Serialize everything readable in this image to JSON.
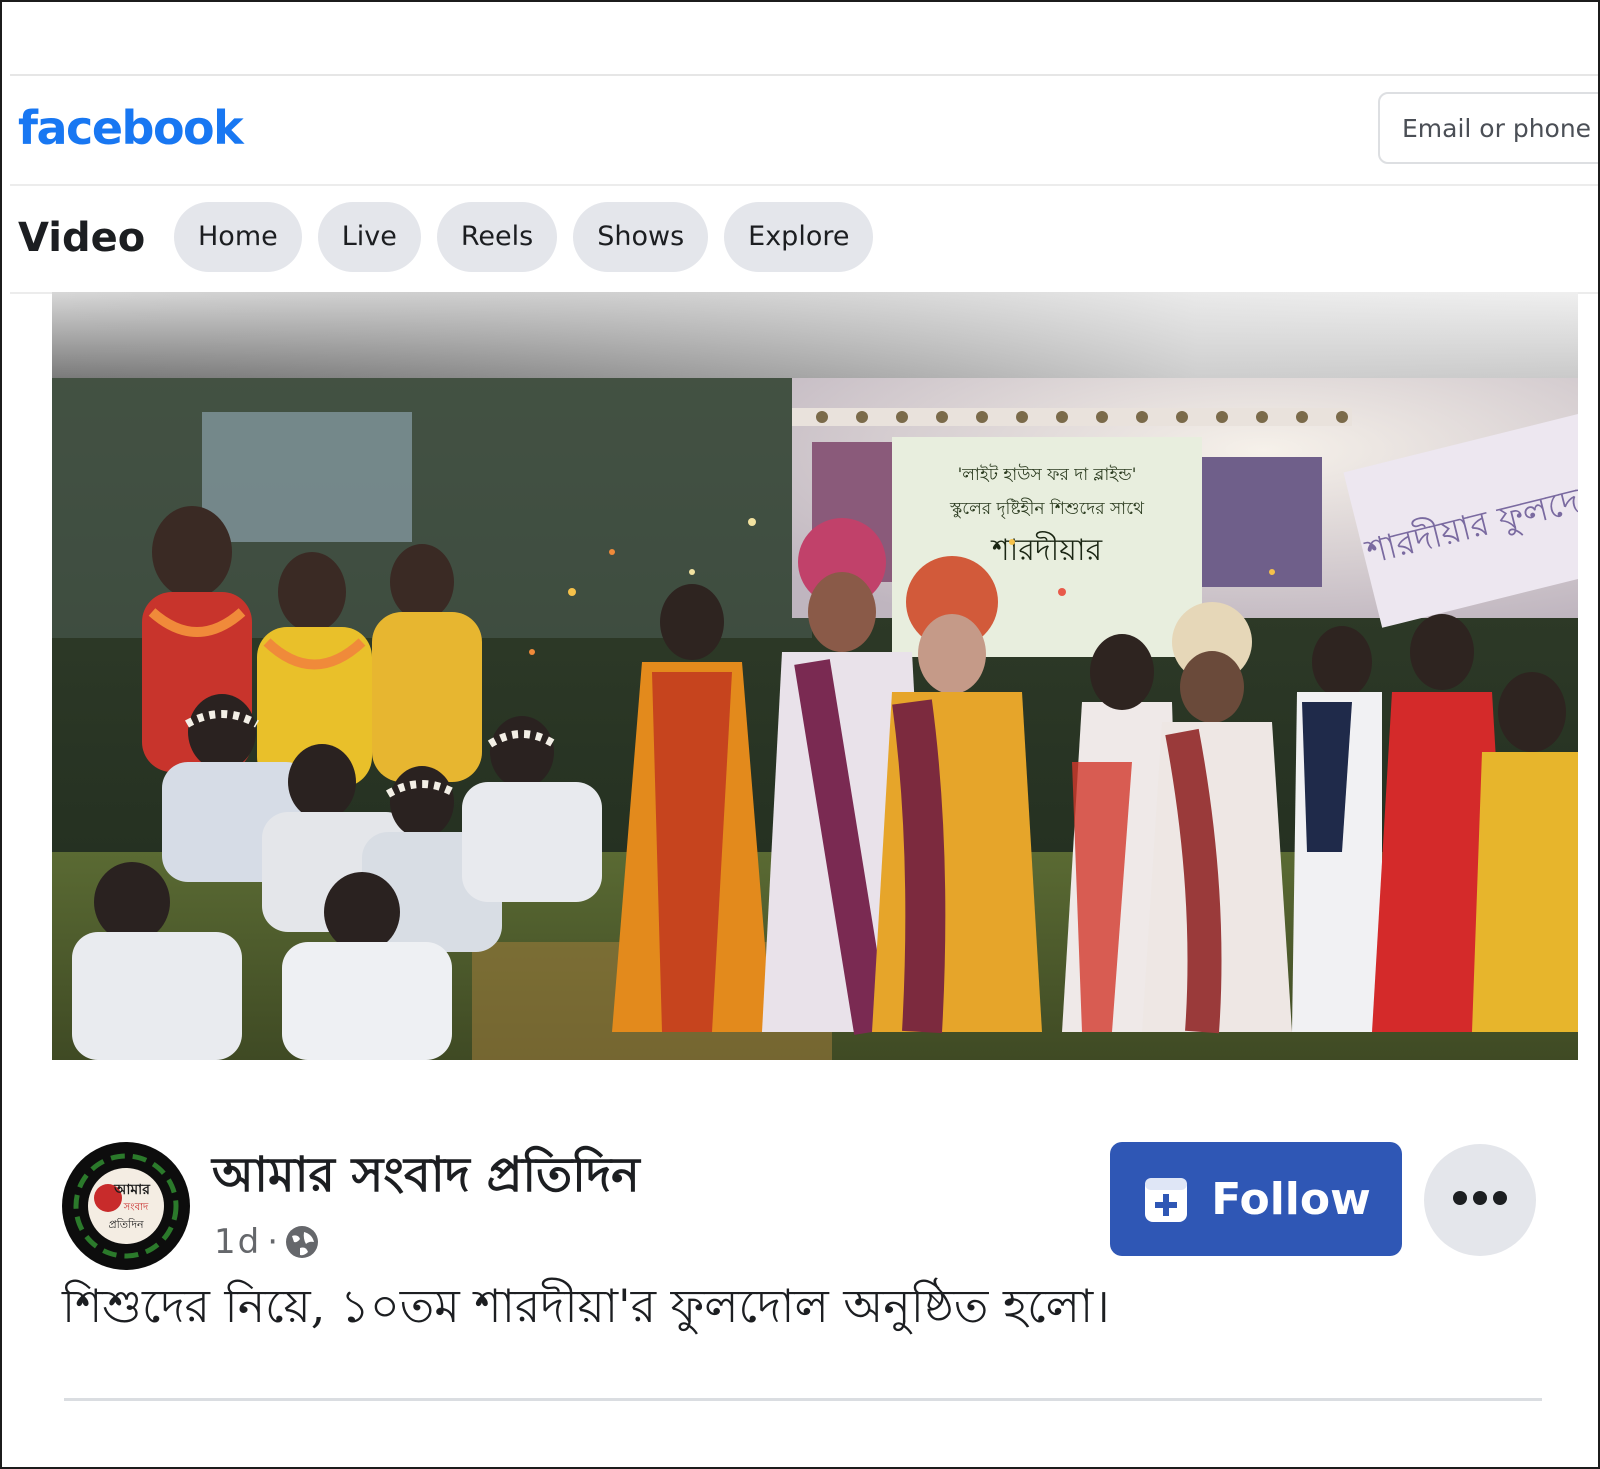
{
  "header": {
    "logo_text": "facebook",
    "login": {
      "email_placeholder": "Email or phone"
    }
  },
  "video_nav": {
    "title": "Video",
    "tabs": [
      {
        "label": "Home"
      },
      {
        "label": "Live"
      },
      {
        "label": "Reels"
      },
      {
        "label": "Shows"
      },
      {
        "label": "Explore"
      }
    ]
  },
  "post": {
    "author": "আমার সংবাদ প্রতিদিন",
    "time": "1d",
    "separator": "·",
    "audience_icon": "globe-icon",
    "follow_label": "Follow",
    "follow_icon": "follow-page-icon",
    "more_icon": "more-options-icon",
    "caption": "শিশুদের নিয়ে, ১০তম শারদীয়া'র ফুলদোল অনুষ্ঠিত হলো।",
    "avatar_logo_lines": [
      "আমার",
      "সংবাদ",
      "প্রতিদিন"
    ]
  },
  "video": {
    "banner_lines": [
      "'লাইট হাউস ফর দা ব্লাইন্ড'",
      "স্কুলের দৃষ্টিহীন শিশুদের সাথে",
      "শারদীয়ার"
    ],
    "side_banner_text": "শারদীয়ার ফুলদোল"
  },
  "colors": {
    "brand_blue": "#1877f2",
    "follow_button": "#2f57b5",
    "pill_gray": "#e4e6eb",
    "text_primary": "#1c1e21",
    "text_secondary": "#65676b"
  }
}
